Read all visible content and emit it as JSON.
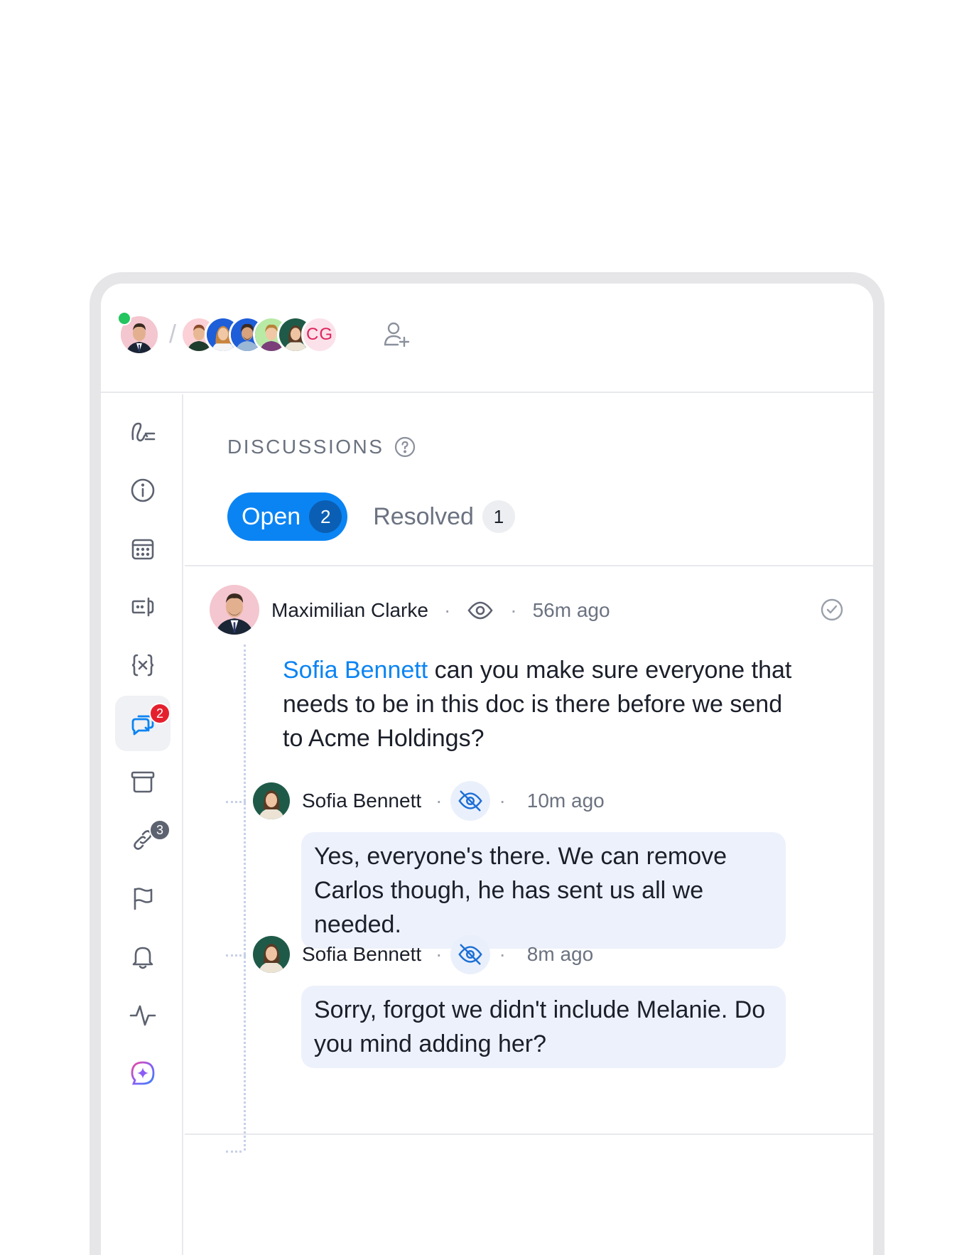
{
  "header": {
    "current_user": {
      "name": "Maximilian Clarke",
      "status": "online"
    },
    "separator": "/",
    "collaborators": [
      {
        "color": "#fbd0d6",
        "skin": "#e8b894",
        "hair": "#8a4a2a",
        "shirt": "#1f3d2e"
      },
      {
        "color": "#1e5ed8",
        "skin": "#f0c8a6",
        "hair": "#c9853f",
        "shirt": "#f5f5f5"
      },
      {
        "color": "#1e5ed8",
        "skin": "#d7a27c",
        "hair": "#3b2a20",
        "shirt": "#9ab7d6"
      },
      {
        "color": "#b8eaa6",
        "skin": "#f0c8a6",
        "hair": "#b88438",
        "shirt": "#7b3f7a"
      },
      {
        "color": "#1f5a48",
        "skin": "#efc4a2",
        "hair": "#5b3a24",
        "shirt": "#ece3d4"
      }
    ],
    "initials_avatar": "CG"
  },
  "sidebar": {
    "items": [
      {
        "icon": "signature-icon"
      },
      {
        "icon": "info-icon"
      },
      {
        "icon": "calendar-icon"
      },
      {
        "icon": "form-field-icon"
      },
      {
        "icon": "variables-icon"
      },
      {
        "icon": "discussions-icon",
        "active": true,
        "badge": "2"
      },
      {
        "icon": "archive-icon"
      },
      {
        "icon": "link-icon",
        "badge": "3"
      },
      {
        "icon": "flag-icon"
      },
      {
        "icon": "bell-icon"
      },
      {
        "icon": "activity-icon"
      },
      {
        "icon": "ai-assistant-icon"
      }
    ]
  },
  "discussions": {
    "title": "DISCUSSIONS",
    "tabs": [
      {
        "label": "Open",
        "count": "2"
      },
      {
        "label": "Resolved",
        "count": "1"
      }
    ]
  },
  "thread": {
    "author": "Maximilian Clarke",
    "separator": "·",
    "time": "56m ago",
    "mention": "Sofia Bennett",
    "text": " can you make sure everyone that needs to be in this doc is there before we send to Acme Holdings?",
    "replies": [
      {
        "author": "Sofia Bennett",
        "time": "10m ago",
        "text": "Yes, everyone's there. We can remove Carlos though, he has sent us all we needed."
      },
      {
        "author": "Sofia Bennett",
        "time": "8m ago",
        "text": "Sorry, forgot we didn't include Melanie. Do you mind adding her?"
      }
    ]
  },
  "colors": {
    "accent": "#0b84f3",
    "badge_red": "#e5202e",
    "online": "#22c55e",
    "bubble": "#edf1fb"
  }
}
